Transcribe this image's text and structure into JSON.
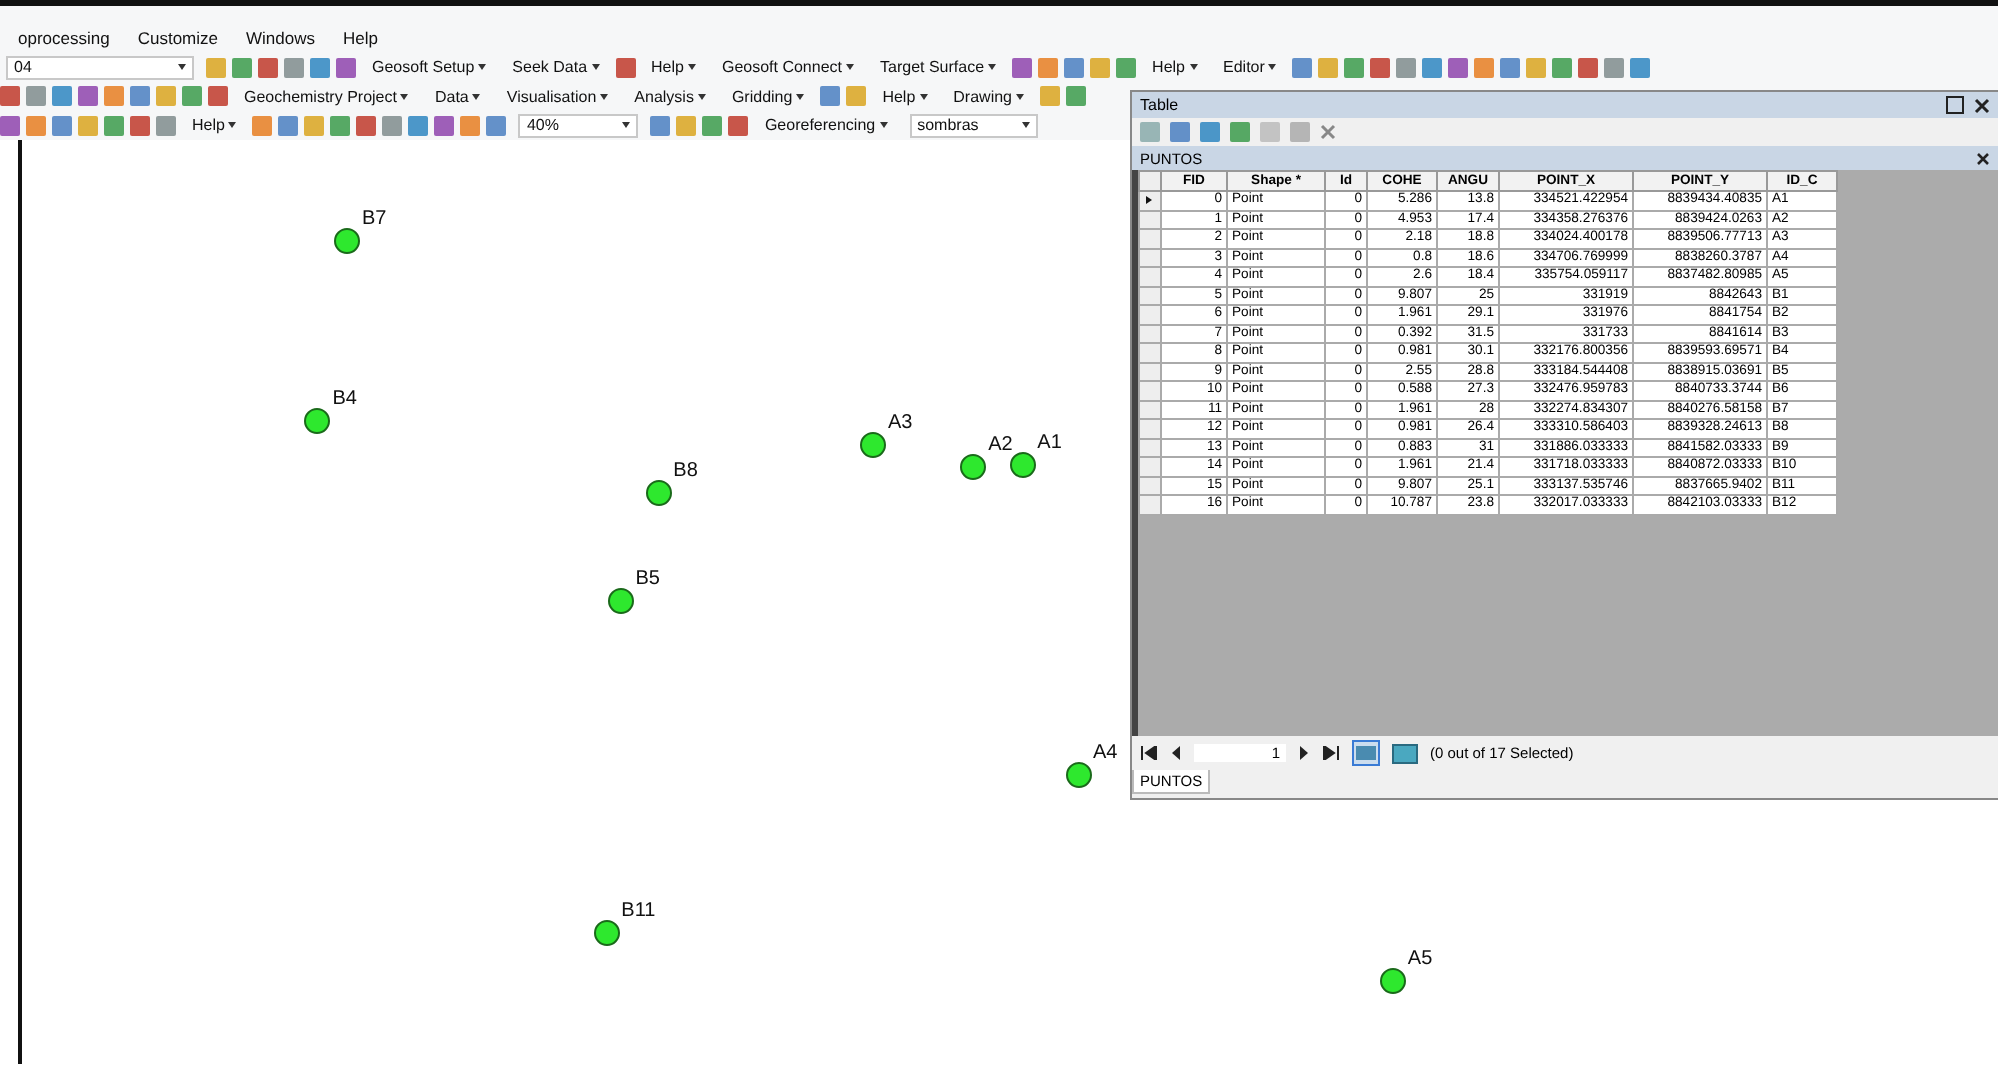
{
  "menu": [
    {
      "label": "oprocessing"
    },
    {
      "label": "Customize"
    },
    {
      "label": "Windows"
    },
    {
      "label": "Help"
    }
  ],
  "toolbars": [
    {
      "items": [
        {
          "kind": "combo",
          "value": "04"
        },
        {
          "kind": "menu",
          "label": "Geosoft Setup"
        },
        {
          "kind": "menu",
          "label": "Seek Data"
        },
        {
          "kind": "menu",
          "label": "Help"
        },
        {
          "kind": "menu",
          "label": "Geosoft Connect"
        },
        {
          "kind": "menu",
          "label": "Target Surface"
        },
        {
          "kind": "menu",
          "label": "Help"
        },
        {
          "kind": "menu",
          "label": "Editor"
        }
      ]
    },
    {
      "items": [
        {
          "kind": "menu",
          "label": "Geochemistry Project"
        },
        {
          "kind": "menu",
          "label": "Data"
        },
        {
          "kind": "menu",
          "label": "Visualisation"
        },
        {
          "kind": "menu",
          "label": "Analysis"
        },
        {
          "kind": "menu",
          "label": "Gridding"
        },
        {
          "kind": "menu",
          "label": "Help"
        },
        {
          "kind": "menu",
          "label": "Drawing"
        }
      ]
    },
    {
      "items": [
        {
          "kind": "menu",
          "label": "Help"
        },
        {
          "kind": "combo",
          "value": "40%"
        },
        {
          "kind": "menu",
          "label": "Georeferencing"
        },
        {
          "kind": "combo",
          "value": "sombras"
        }
      ]
    }
  ],
  "map": {
    "points": [
      {
        "label": "B7"
      },
      {
        "label": "B4"
      },
      {
        "label": "A3"
      },
      {
        "label": "A2"
      },
      {
        "label": "A1"
      },
      {
        "label": "B8"
      },
      {
        "label": "B5"
      },
      {
        "label": "A4"
      },
      {
        "label": "B11"
      },
      {
        "label": "A5"
      }
    ]
  },
  "table_window": {
    "title": "Table",
    "layer": "PUNTOS",
    "columns": [
      {
        "label": "FID",
        "kind": "number"
      },
      {
        "label": "Shape *",
        "kind": "text"
      },
      {
        "label": "Id",
        "kind": "number"
      },
      {
        "label": "COHE",
        "kind": "number"
      },
      {
        "label": "ANGU",
        "kind": "number"
      },
      {
        "label": "POINT_X",
        "kind": "number"
      },
      {
        "label": "POINT_Y",
        "kind": "number"
      },
      {
        "label": "ID_C",
        "kind": "text"
      }
    ],
    "rows": [
      {
        "current": true,
        "cells": [
          "0",
          "Point",
          "0",
          "5.286",
          "13.8",
          "334521.422954",
          "8839434.40835",
          "A1"
        ]
      },
      {
        "current": false,
        "cells": [
          "1",
          "Point",
          "0",
          "4.953",
          "17.4",
          "334358.276376",
          "8839424.0263",
          "A2"
        ]
      },
      {
        "current": false,
        "cells": [
          "2",
          "Point",
          "0",
          "2.18",
          "18.8",
          "334024.400178",
          "8839506.77713",
          "A3"
        ]
      },
      {
        "current": false,
        "cells": [
          "3",
          "Point",
          "0",
          "0.8",
          "18.6",
          "334706.769999",
          "8838260.3787",
          "A4"
        ]
      },
      {
        "current": false,
        "cells": [
          "4",
          "Point",
          "0",
          "2.6",
          "18.4",
          "335754.059117",
          "8837482.80985",
          "A5"
        ]
      },
      {
        "current": false,
        "cells": [
          "5",
          "Point",
          "0",
          "9.807",
          "25",
          "331919",
          "8842643",
          "B1"
        ]
      },
      {
        "current": false,
        "cells": [
          "6",
          "Point",
          "0",
          "1.961",
          "29.1",
          "331976",
          "8841754",
          "B2"
        ]
      },
      {
        "current": false,
        "cells": [
          "7",
          "Point",
          "0",
          "0.392",
          "31.5",
          "331733",
          "8841614",
          "B3"
        ]
      },
      {
        "current": false,
        "cells": [
          "8",
          "Point",
          "0",
          "0.981",
          "30.1",
          "332176.800356",
          "8839593.69571",
          "B4"
        ]
      },
      {
        "current": false,
        "cells": [
          "9",
          "Point",
          "0",
          "2.55",
          "28.8",
          "333184.544408",
          "8838915.03691",
          "B5"
        ]
      },
      {
        "current": false,
        "cells": [
          "10",
          "Point",
          "0",
          "0.588",
          "27.3",
          "332476.959783",
          "8840733.3744",
          "B6"
        ]
      },
      {
        "current": false,
        "cells": [
          "11",
          "Point",
          "0",
          "1.961",
          "28",
          "332274.834307",
          "8840276.58158",
          "B7"
        ]
      },
      {
        "current": false,
        "cells": [
          "12",
          "Point",
          "0",
          "0.981",
          "26.4",
          "333310.586403",
          "8839328.24613",
          "B8"
        ]
      },
      {
        "current": false,
        "cells": [
          "13",
          "Point",
          "0",
          "0.883",
          "31",
          "331886.033333",
          "8841582.03333",
          "B9"
        ]
      },
      {
        "current": false,
        "cells": [
          "14",
          "Point",
          "0",
          "1.961",
          "21.4",
          "331718.033333",
          "8840872.03333",
          "B10"
        ]
      },
      {
        "current": false,
        "cells": [
          "15",
          "Point",
          "0",
          "9.807",
          "25.1",
          "333137.535746",
          "8837665.9402",
          "B11"
        ]
      },
      {
        "current": false,
        "cells": [
          "16",
          "Point",
          "0",
          "10.787",
          "23.8",
          "332017.033333",
          "8842103.03333",
          "B12"
        ]
      }
    ],
    "record": "1",
    "status": "(0 out of 17 Selected)",
    "tab": {
      "label": "PUNTOS",
      "selected": true
    }
  }
}
